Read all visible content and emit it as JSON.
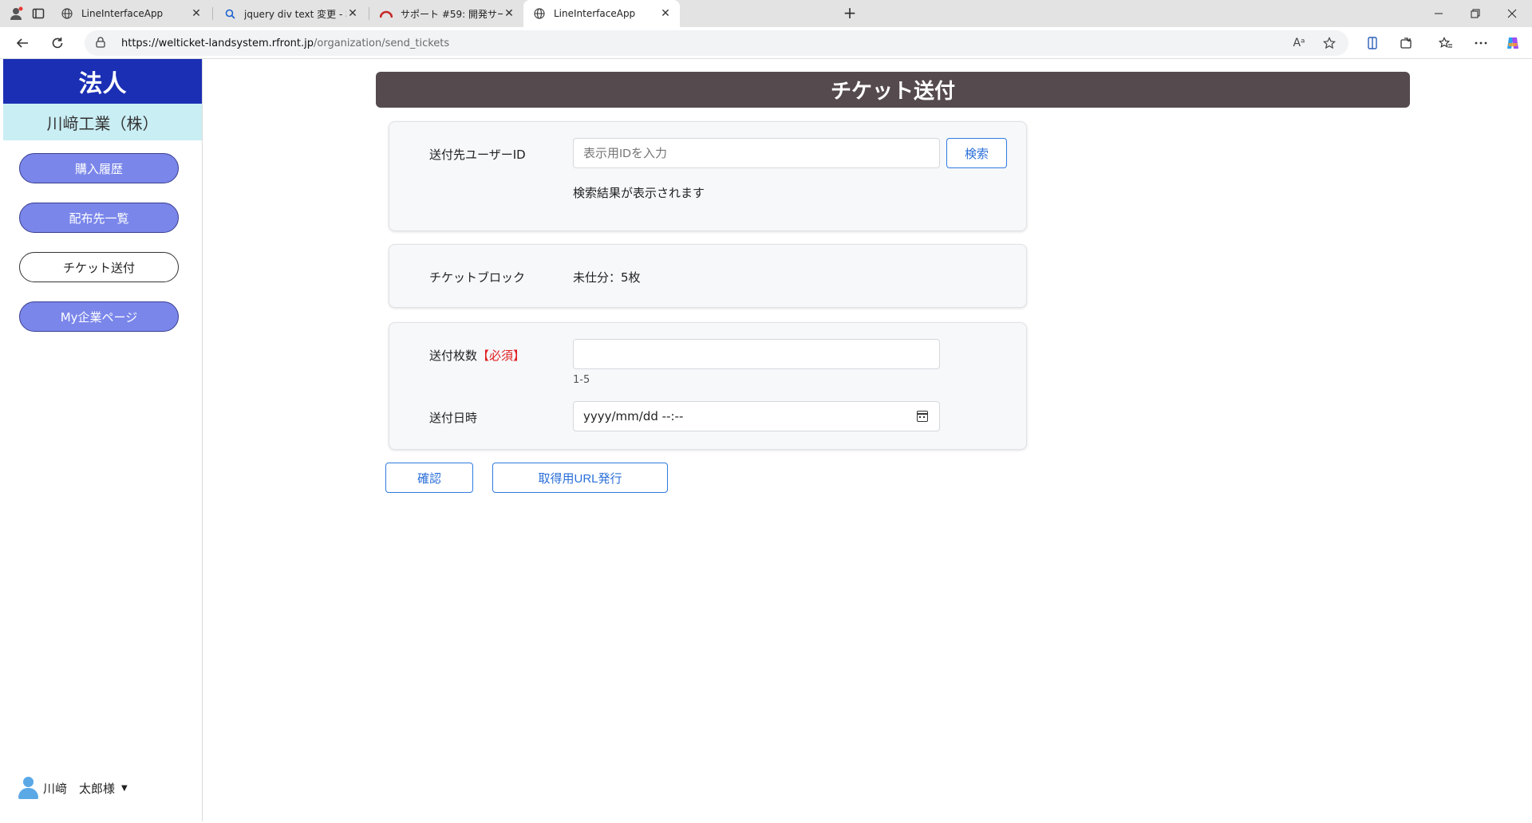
{
  "browser": {
    "tabs": [
      {
        "title": "LineInterfaceApp",
        "favicon": "globe-icon"
      },
      {
        "title": "jquery div text 変更 - 検索",
        "favicon": "search-icon"
      },
      {
        "title": "サポート #59: 開発サーバー運用方法",
        "favicon": "redmine-icon"
      },
      {
        "title": "LineInterfaceApp",
        "favicon": "globe-icon",
        "active": true
      }
    ],
    "url_host": "https://welticket-landsystem.rfront.jp",
    "url_path": "/organization/send_tickets"
  },
  "sidebar": {
    "brand": "法人",
    "company": "川﨑工業（株）",
    "nav": [
      {
        "label": "購入履歴"
      },
      {
        "label": "配布先一覧"
      },
      {
        "label": "チケット送付",
        "current": true
      },
      {
        "label": "My企業ページ"
      }
    ],
    "user_name": "川﨑　太郎様"
  },
  "page": {
    "title": "チケット送付",
    "recipient": {
      "label": "送付先ユーザーID",
      "placeholder": "表示用IDを入力",
      "search_label": "検索",
      "result_text": "検索結果が表示されます"
    },
    "block": {
      "label": "チケットブロック",
      "value": "未仕分：5枚"
    },
    "send": {
      "count_label": "送付枚数",
      "required_mark": "【必須】",
      "count_value": "",
      "count_hint": "1-5",
      "date_label": "送付日時",
      "date_value": "yyyy/mm/dd --:--"
    },
    "actions": {
      "confirm_label": "確認",
      "url_label": "取得用URL発行"
    }
  },
  "colors": {
    "brand": "#1b2fb4",
    "company_bg": "#c9eef4",
    "nav_pill": "#7a86ea",
    "title_bar": "#554a4d",
    "primary_outline": "#2f7be0",
    "required": "#e02020"
  }
}
